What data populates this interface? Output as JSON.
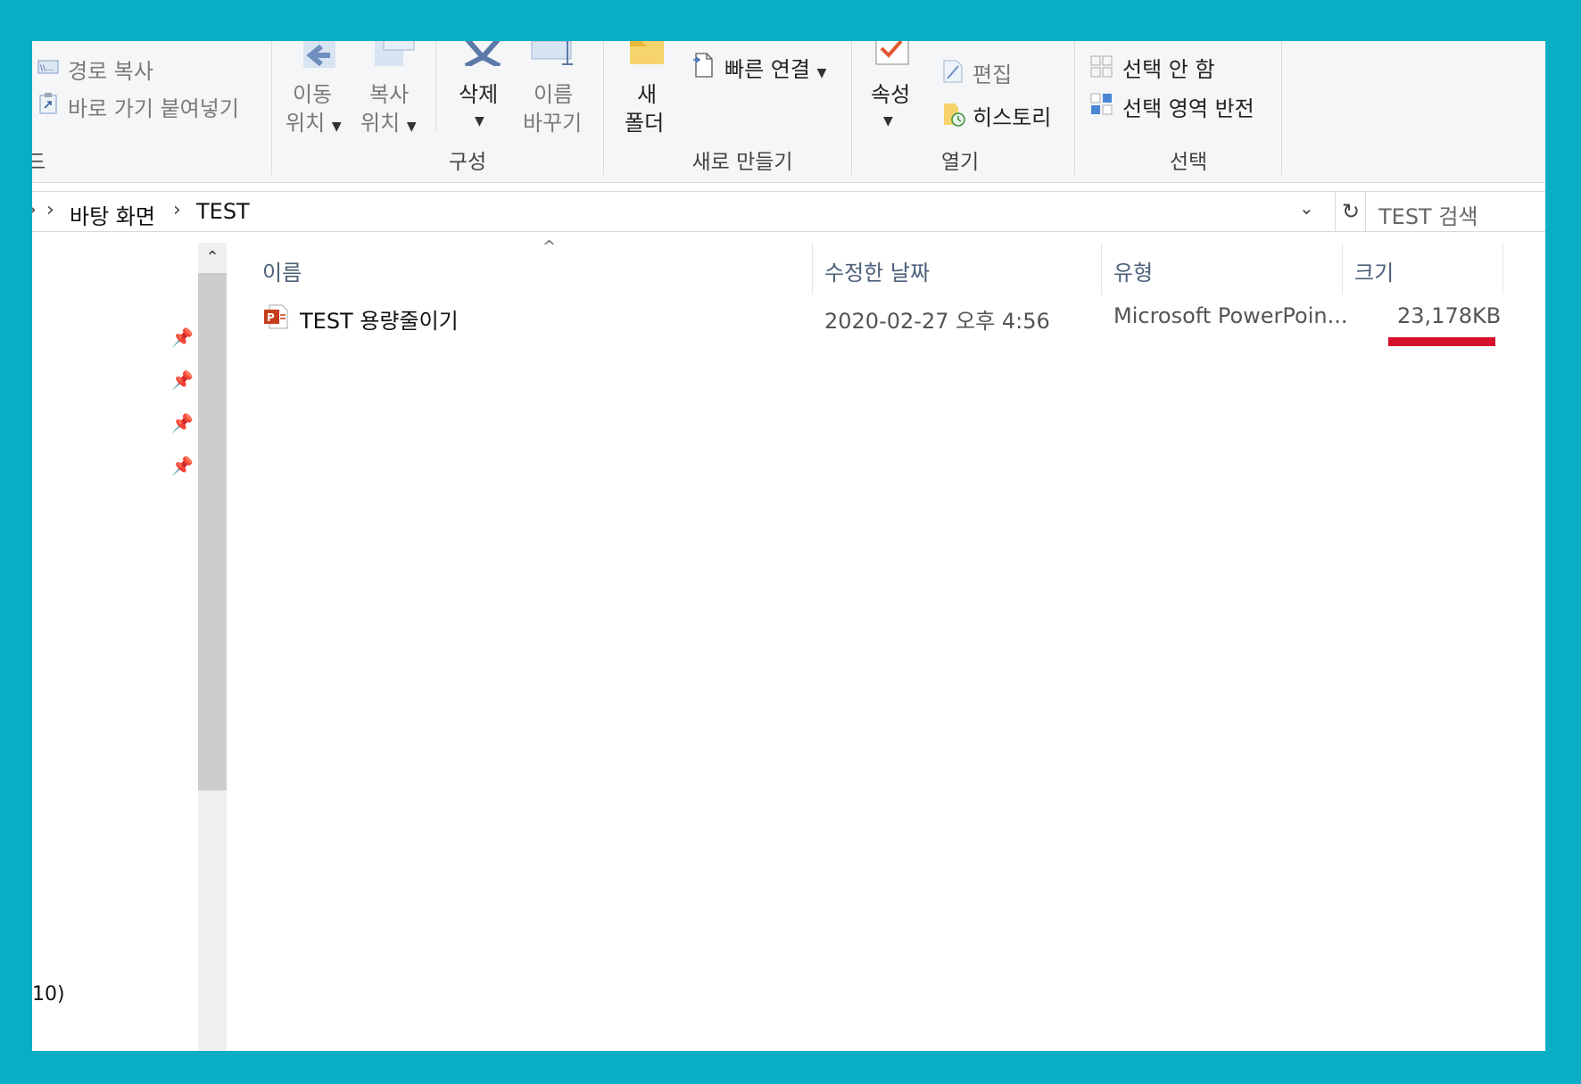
{
  "ribbon": {
    "clipboard": {
      "copy_path": "경로 복사",
      "paste_shortcut": "바로 가기 붙여넣기",
      "group_label_fragment": "드"
    },
    "organize": {
      "move_to_line1": "이동",
      "move_to_line2": "위치",
      "copy_to_line1": "복사",
      "copy_to_line2": "위치",
      "delete": "삭제",
      "rename_line1": "이름",
      "rename_line2": "바꾸기",
      "group_label": "구성"
    },
    "new": {
      "new_folder_line1": "새",
      "new_folder_line2": "폴더",
      "easy_access": "빠른 연결",
      "group_label": "새로 만들기"
    },
    "open": {
      "properties": "속성",
      "edit": "편집",
      "history": "히스토리",
      "group_label": "열기"
    },
    "select": {
      "select_none": "선택 안 함",
      "invert_selection": "선택 영역 반전",
      "group_label": "선택"
    }
  },
  "address": {
    "crumbs": [
      "바탕 화면",
      "TEST"
    ],
    "search_placeholder": "TEST 검색"
  },
  "nav": {
    "bottom_fragment": "10)"
  },
  "columns": {
    "name": "이름",
    "modified": "수정한 날짜",
    "type": "유형",
    "size": "크기"
  },
  "files": [
    {
      "name": "TEST 용량줄이기",
      "modified": "2020-02-27 오후 4:56",
      "type": "Microsoft PowerPoin...",
      "size": "23,178KB"
    }
  ],
  "colors": {
    "frame": "#0aaec4",
    "highlight": "#d6102a",
    "ppt": "#c43e1c"
  }
}
